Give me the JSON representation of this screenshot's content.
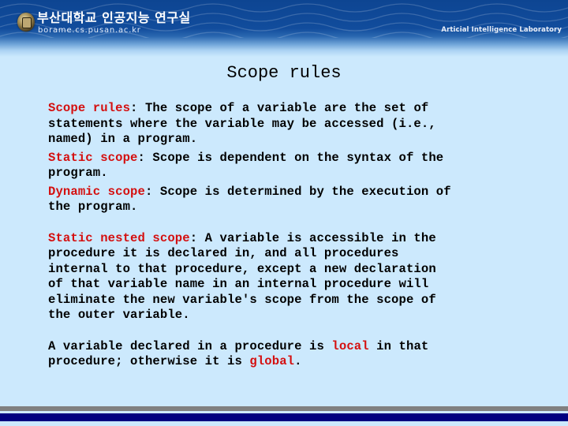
{
  "header": {
    "logo_korean": "부산대학교 인공지능 연구실",
    "logo_url": "borame.cs.pusan.ac.kr",
    "lab_name": "Articial Intelligence Laboratory",
    "emblem_icon": "university-emblem-icon"
  },
  "slide": {
    "title": "Scope rules",
    "paragraphs": [
      {
        "term": "Scope rules",
        "lines": [
          ": The scope of a variable are the set of",
          "statements where the variable may be accessed (i.e.,",
          "named) in a program."
        ]
      },
      {
        "term": "Static scope",
        "lines": [
          ": Scope is dependent on the syntax of the",
          "program."
        ]
      },
      {
        "term": "Dynamic scope",
        "lines": [
          ": Scope is determined by the execution of",
          "the program."
        ]
      },
      {
        "term": "Static nested scope",
        "lines": [
          ": A variable is accessible in the",
          "procedure it is declared in, and all procedures",
          "internal to that procedure, except a new declaration",
          "of that variable name in an internal procedure will",
          "eliminate the new variable's scope from the scope of",
          "the outer variable."
        ]
      },
      {
        "line1_before": "A variable declared in a procedure is ",
        "line1_term": "local",
        "line1_after": " in that",
        "line2_before": "procedure; otherwise it is ",
        "line2_term": "global",
        "line2_after": "."
      }
    ]
  },
  "colors": {
    "background": "#cce9fd",
    "header_blue": "#0d4592",
    "term_red": "#d41010",
    "text": "#000000",
    "footer_gray": "#808080",
    "footer_navy": "#000080"
  }
}
